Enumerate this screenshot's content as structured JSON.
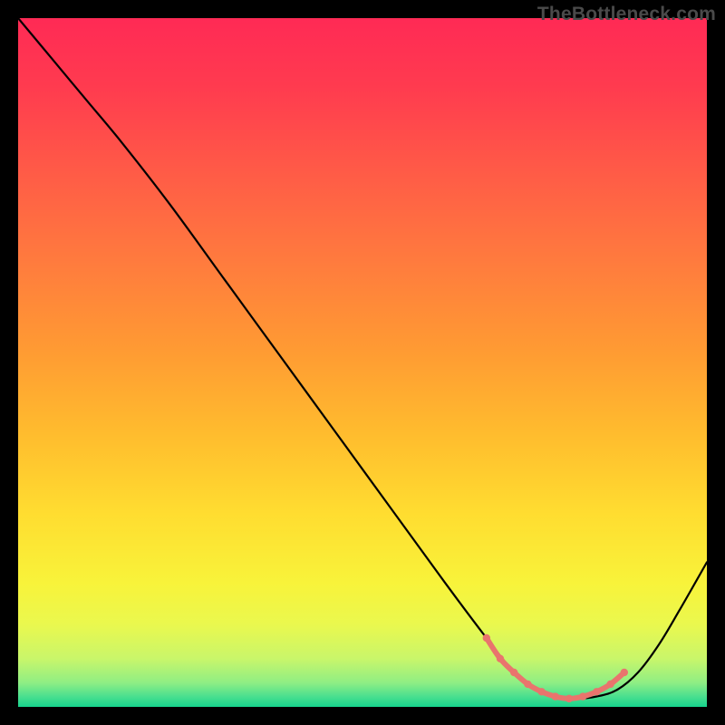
{
  "watermark": "TheBottleneck.com",
  "chart_data": {
    "type": "line",
    "title": "",
    "xlabel": "",
    "ylabel": "",
    "xlim": [
      0,
      100
    ],
    "ylim": [
      0,
      100
    ],
    "grid": false,
    "legend": false,
    "series": [
      {
        "name": "bottleneck-curve",
        "x": [
          0,
          5,
          10,
          15,
          22,
          30,
          38,
          46,
          54,
          62,
          68,
          72,
          75,
          78,
          81,
          84,
          87,
          90,
          93,
          96,
          100
        ],
        "y": [
          100,
          94,
          88,
          82,
          73,
          62,
          51,
          40,
          29,
          18,
          10,
          5,
          2.5,
          1.5,
          1.2,
          1.5,
          2.5,
          5,
          9,
          14,
          21
        ],
        "color": "#000000",
        "width": 2.2
      },
      {
        "name": "optimal-range-highlight",
        "x": [
          68,
          70,
          72,
          74,
          76,
          78,
          80,
          82,
          84,
          86,
          88
        ],
        "y": [
          10,
          7,
          5,
          3.3,
          2.2,
          1.5,
          1.2,
          1.5,
          2.2,
          3.3,
          5
        ],
        "color": "#e9746d",
        "width": 6
      }
    ],
    "gradient_stops": [
      {
        "offset": 0.0,
        "color": "#ff2a55"
      },
      {
        "offset": 0.1,
        "color": "#ff3b4f"
      },
      {
        "offset": 0.22,
        "color": "#ff5a47"
      },
      {
        "offset": 0.35,
        "color": "#ff7a3e"
      },
      {
        "offset": 0.48,
        "color": "#ff9a33"
      },
      {
        "offset": 0.6,
        "color": "#ffbb2e"
      },
      {
        "offset": 0.72,
        "color": "#ffdd30"
      },
      {
        "offset": 0.82,
        "color": "#f8f33a"
      },
      {
        "offset": 0.88,
        "color": "#eaf84e"
      },
      {
        "offset": 0.93,
        "color": "#c9f66a"
      },
      {
        "offset": 0.965,
        "color": "#8fee84"
      },
      {
        "offset": 0.985,
        "color": "#4adf8f"
      },
      {
        "offset": 1.0,
        "color": "#17d48d"
      }
    ]
  }
}
